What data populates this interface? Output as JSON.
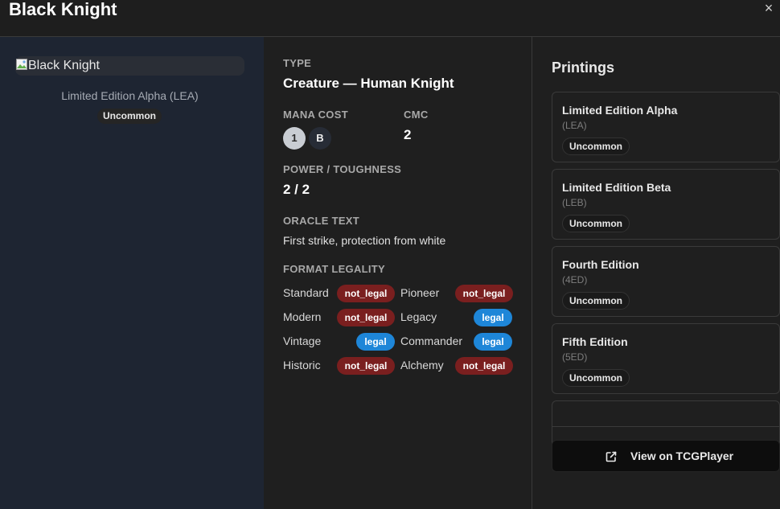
{
  "header": {
    "title": "Black Knight",
    "close_glyph": "×"
  },
  "card": {
    "image_alt": "Black Knight",
    "set_line": "Limited Edition Alpha (LEA)",
    "rarity": "Uncommon"
  },
  "details": {
    "type_label": "TYPE",
    "type_value": "Creature — Human Knight",
    "mana_label": "MANA COST",
    "mana_symbols": [
      "1",
      "B"
    ],
    "cmc_label": "CMC",
    "cmc_value": "2",
    "pt_label": "POWER / TOUGHNESS",
    "pt_value": "2 / 2",
    "oracle_label": "ORACLE TEXT",
    "oracle_text": "First strike, protection from white",
    "legality_label": "FORMAT LEGALITY",
    "legality": [
      {
        "format": "Standard",
        "status": "not_legal"
      },
      {
        "format": "Pioneer",
        "status": "not_legal"
      },
      {
        "format": "Modern",
        "status": "not_legal"
      },
      {
        "format": "Legacy",
        "status": "legal"
      },
      {
        "format": "Vintage",
        "status": "legal"
      },
      {
        "format": "Commander",
        "status": "legal"
      },
      {
        "format": "Historic",
        "status": "not_legal"
      },
      {
        "format": "Alchemy",
        "status": "not_legal"
      }
    ]
  },
  "printings": {
    "title": "Printings",
    "items": [
      {
        "name": "Limited Edition Alpha",
        "code": "(LEA)",
        "rarity": "Uncommon"
      },
      {
        "name": "Limited Edition Beta",
        "code": "(LEB)",
        "rarity": "Uncommon"
      },
      {
        "name": "Fourth Edition",
        "code": "(4ED)",
        "rarity": "Uncommon"
      },
      {
        "name": "Fifth Edition",
        "code": "(5ED)",
        "rarity": "Uncommon"
      }
    ],
    "button_label": "View on TCGPlayer"
  },
  "colors": {
    "not_legal": "#7a1f1f",
    "legal": "#1e86d8",
    "left_panel": "#1e2532",
    "background": "#1f1f1f"
  },
  "icons": {
    "close": "close-icon",
    "external": "external-link-icon",
    "broken_image": "broken-image-icon"
  }
}
